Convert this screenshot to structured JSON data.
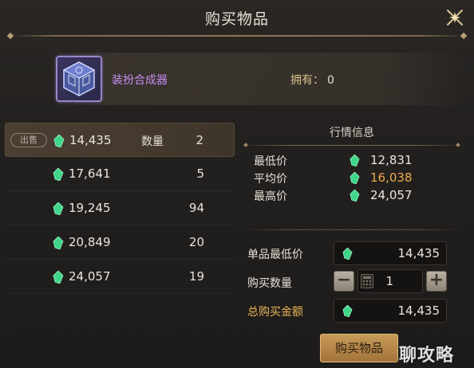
{
  "window": {
    "title": "购买物品"
  },
  "item": {
    "name": "装扮合成器",
    "owned_label": "拥有：",
    "owned_value": "0"
  },
  "sell_list": {
    "selected_tag": "出售",
    "qty_label": "数量",
    "rows": [
      {
        "price": "14,435",
        "qty": "2",
        "selected": true
      },
      {
        "price": "17,641",
        "qty": "5"
      },
      {
        "price": "19,245",
        "qty": "94"
      },
      {
        "price": "20,849",
        "qty": "20"
      },
      {
        "price": "24,057",
        "qty": "19"
      }
    ]
  },
  "market": {
    "title": "行情信息",
    "min_label": "最低价",
    "min_value": "12,831",
    "avg_label": "平均价",
    "avg_value": "16,038",
    "max_label": "最高价",
    "max_value": "24,057"
  },
  "purchase": {
    "unit_price_label": "单品最低价",
    "unit_price_value": "14,435",
    "quantity_label": "购买数量",
    "quantity_value": "1",
    "total_label": "总购买金额",
    "total_value": "14,435",
    "buy_button": "购买物品"
  },
  "watermark": "聊攻略",
  "colors": {
    "item_name": "#c78cf2",
    "average_price": "#f0a84a",
    "total_label": "#e9b558",
    "gem": "#3fd68a",
    "buy_button": "#b8874a"
  },
  "icons": {
    "close": "close-icon",
    "item": "item-icon",
    "currency": "gem-icon",
    "minus": "minus-icon",
    "plus": "plus-icon",
    "calculator": "calculator-icon"
  }
}
